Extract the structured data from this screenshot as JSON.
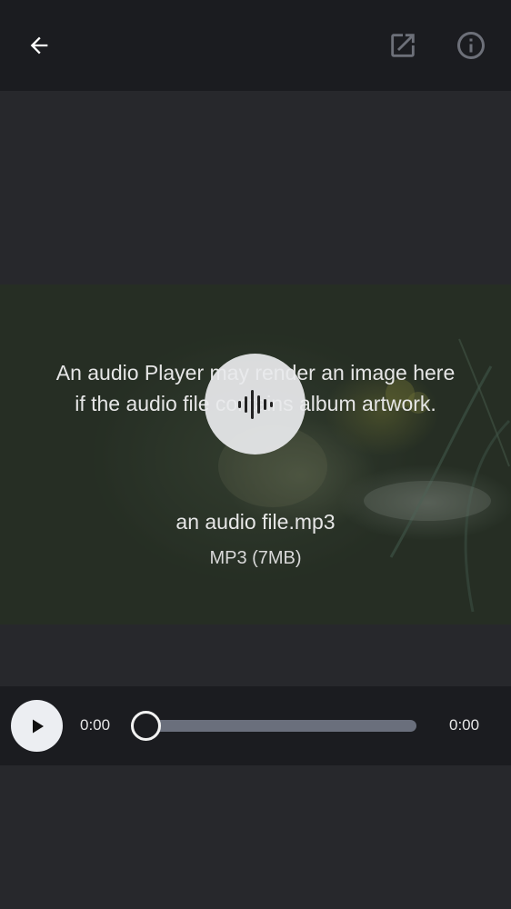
{
  "toolbar": {
    "back_icon": "arrow-left-icon",
    "open_external_icon": "open-in-new-icon",
    "info_icon": "info-circle-icon"
  },
  "artwork": {
    "placeholder_text": "An audio Player may render an image here if the audio file contains album artwork.",
    "waveform_icon": "audio-waveform-icon",
    "file_name": "an audio file.mp3",
    "file_meta": "MP3 (7MB)"
  },
  "player": {
    "play_icon": "play-icon",
    "current_time": "0:00",
    "total_time": "0:00",
    "progress": 0
  },
  "colors": {
    "toolbar_bg": "#1b1c20",
    "page_bg": "#27282c",
    "track": "#6a6f7c",
    "button_bg": "#eceef2"
  }
}
